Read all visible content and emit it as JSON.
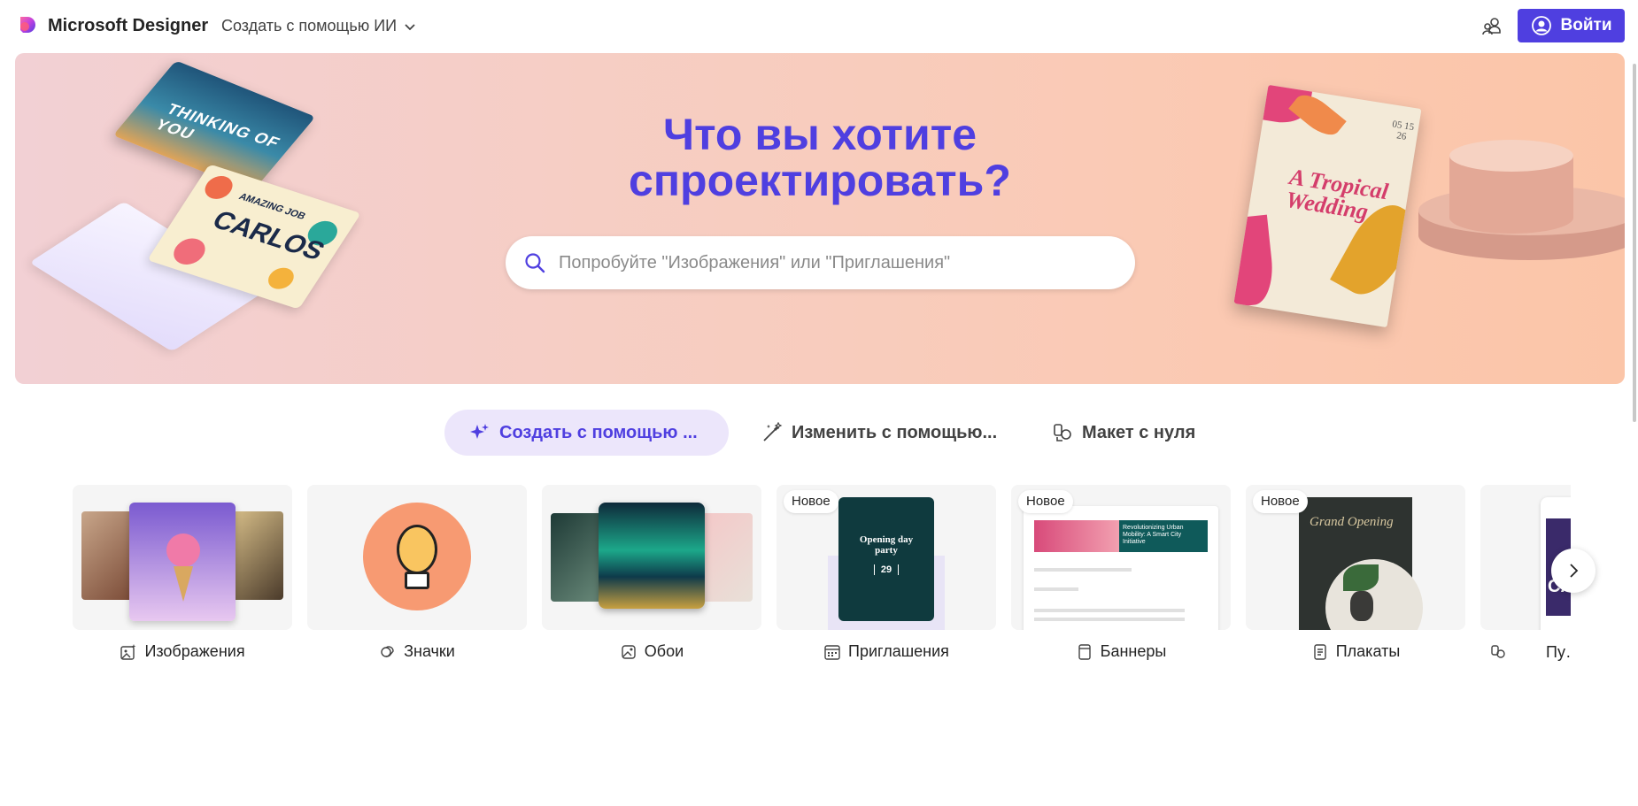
{
  "header": {
    "brand": "Microsoft Designer",
    "nav_dropdown": "Создать с помощью ИИ",
    "signin_label": "Войти",
    "icons": [
      "designer-logo",
      "chevron-down-icon",
      "people-icon",
      "user-circle-icon"
    ]
  },
  "hero": {
    "title_line1": "Что вы хотите",
    "title_line2": "спроектировать?",
    "search_placeholder": "Попробуйте \"Изображения\" или \"Приглашения\"",
    "card1_text": "THINKING OF YOU",
    "card2_sub": "AMAZING JOB",
    "card2_text": "CARLOS",
    "invite_title": "A Tropical Wedding",
    "invite_date": "05 15 26"
  },
  "tabs": [
    {
      "label": "Создать с помощью ...",
      "icon": "sparkle-icon",
      "active": true
    },
    {
      "label": "Изменить с помощью...",
      "icon": "magic-wand-icon",
      "active": false
    },
    {
      "label": "Макет с нуля",
      "icon": "layout-icon",
      "active": false
    }
  ],
  "categories": [
    {
      "label": "Изображения",
      "icon": "image-sparkle-icon",
      "badge": ""
    },
    {
      "label": "Значки",
      "icon": "sticker-icon",
      "badge": ""
    },
    {
      "label": "Обои",
      "icon": "wallpaper-icon",
      "badge": ""
    },
    {
      "label": "Приглашения",
      "icon": "calendar-icon",
      "badge": "Новое",
      "card_title": "Opening day party",
      "card_date": "29"
    },
    {
      "label": "Баннеры",
      "icon": "banner-icon",
      "badge": "Новое",
      "card_title": "Revolutionizing Urban Mobility: A Smart City Initiative"
    },
    {
      "label": "Плакаты",
      "icon": "poster-icon",
      "badge": "Новое",
      "card_title": "Grand Opening"
    },
    {
      "label": "Пу… соци…",
      "icon": "social-post-icon",
      "badge": "",
      "card_title": "CA"
    }
  ],
  "colors": {
    "accent": "#4f3fe0",
    "tab_active_bg": "#ece6fb"
  }
}
